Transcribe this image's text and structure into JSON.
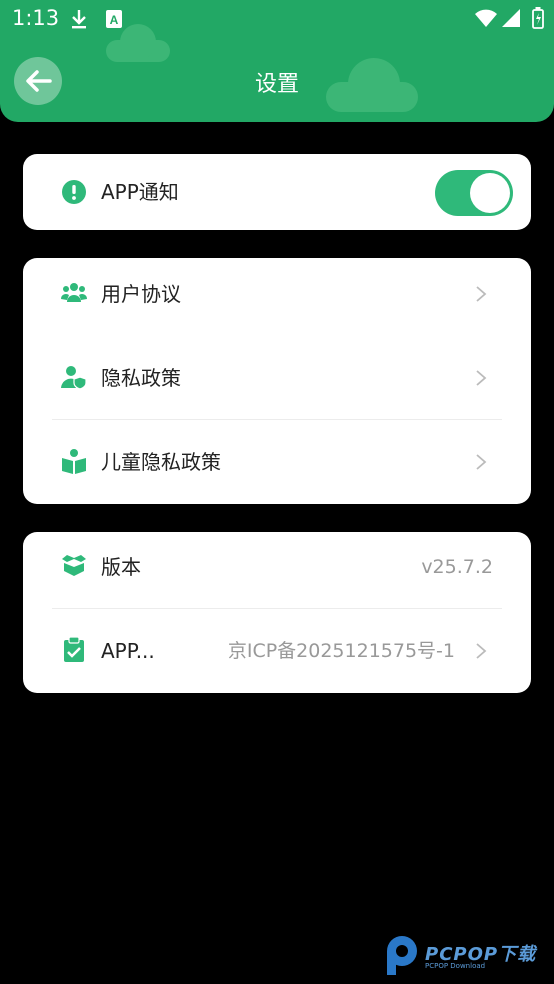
{
  "status_bar": {
    "time": "1:13"
  },
  "header": {
    "title": "设置"
  },
  "notification": {
    "label": "APP通知",
    "enabled": true
  },
  "legal": {
    "items": [
      {
        "label": "用户协议"
      },
      {
        "label": "隐私政策"
      },
      {
        "label": "儿童隐私政策"
      }
    ]
  },
  "info": {
    "version_label": "版本",
    "version_value": "v25.7.2",
    "icp_label": "APP...",
    "icp_value": "京ICP备2025121575号-1"
  },
  "watermark": {
    "text": "PCPOP下载",
    "sub": "PCPOP Download"
  },
  "colors": {
    "brand_green": "#22a865",
    "toggle_on": "#2fb97a",
    "icon_green": "#2fb97a"
  }
}
